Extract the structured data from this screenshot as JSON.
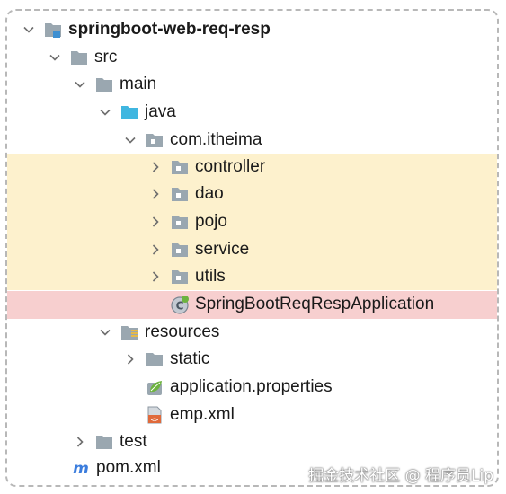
{
  "tree": {
    "root": {
      "label": "springboot-web-req-resp",
      "icon": "module-folder-icon",
      "expanded": true
    },
    "src": {
      "label": "src",
      "icon": "folder-icon",
      "expanded": true
    },
    "main": {
      "label": "main",
      "icon": "folder-icon",
      "expanded": true
    },
    "java": {
      "label": "java",
      "icon": "source-folder-icon",
      "expanded": true
    },
    "package": {
      "label": "com.itheima",
      "icon": "package-icon",
      "expanded": true
    },
    "packages": [
      {
        "label": "controller",
        "icon": "package-icon",
        "expanded": false
      },
      {
        "label": "dao",
        "icon": "package-icon",
        "expanded": false
      },
      {
        "label": "pojo",
        "icon": "package-icon",
        "expanded": false
      },
      {
        "label": "service",
        "icon": "package-icon",
        "expanded": false
      },
      {
        "label": "utils",
        "icon": "package-icon",
        "expanded": false
      }
    ],
    "app_class": {
      "label": "SpringBootReqRespApplication",
      "icon": "spring-boot-class-icon"
    },
    "resources": {
      "label": "resources",
      "icon": "resources-folder-icon",
      "expanded": true
    },
    "static": {
      "label": "static",
      "icon": "folder-icon",
      "expanded": false
    },
    "app_props": {
      "label": "application.properties",
      "icon": "spring-properties-icon"
    },
    "emp_xml": {
      "label": "emp.xml",
      "icon": "xml-file-icon"
    },
    "test": {
      "label": "test",
      "icon": "folder-icon",
      "expanded": false
    },
    "pom": {
      "label": "pom.xml",
      "icon": "maven-icon"
    }
  },
  "highlight_colors": {
    "packages": "#fdf1cd",
    "app_class": "#f7cfcf"
  },
  "watermark": "掘金技术社区 @ 程序员Lip"
}
